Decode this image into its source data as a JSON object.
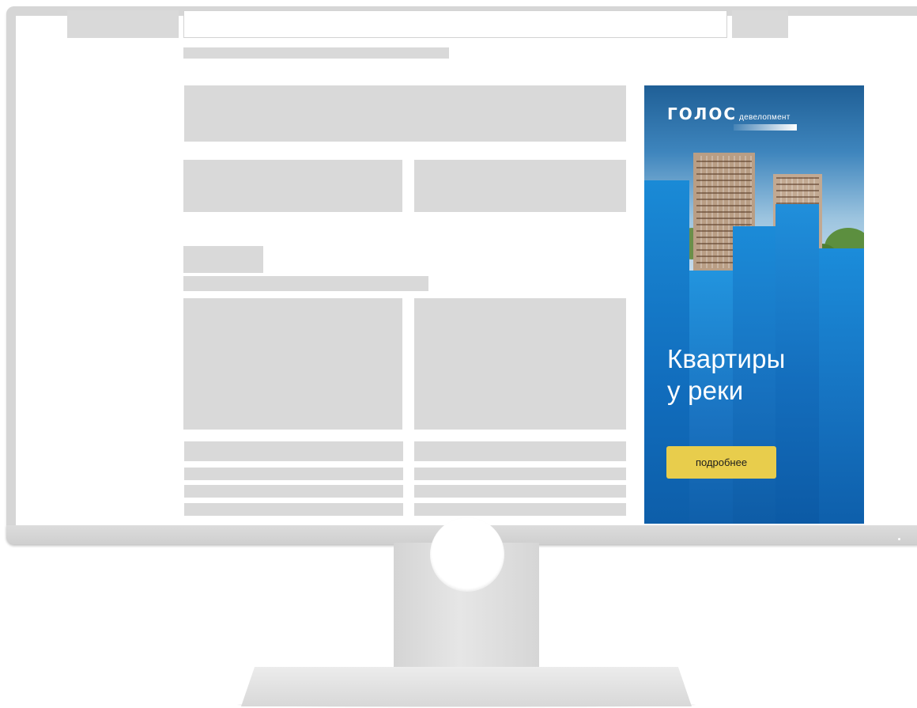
{
  "ad": {
    "brand": "ГОЛОС",
    "brand_sub": "девелопмент",
    "headline_line1": "Квартиры",
    "headline_line2": "у реки",
    "cta_label": "подробнее",
    "cta_color": "#e8cd4c",
    "accent_color": "#136bbd"
  },
  "colors": {
    "placeholder": "#d9d9d9",
    "monitor_bezel": "#d6d6d6"
  }
}
